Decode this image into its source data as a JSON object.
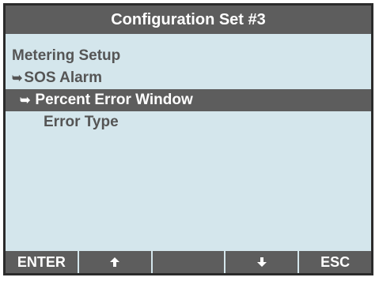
{
  "title": "Configuration Set #3",
  "menu": {
    "items": [
      {
        "label": "Metering Setup",
        "arrow": ""
      },
      {
        "label": "SOS Alarm",
        "arrow": "➥"
      },
      {
        "label": "Percent Error Window",
        "arrow": "➥"
      },
      {
        "label": "Error Type",
        "arrow": ""
      }
    ],
    "selected_index": 2
  },
  "softkeys": {
    "key1": "ENTER",
    "key2_icon": "arrow-up-icon",
    "key2_glyph": "🡅",
    "key3": "",
    "key4_icon": "arrow-down-icon",
    "key4_glyph": "🡇",
    "key5": "ESC"
  },
  "colors": {
    "screen_bg": "#d4e6ec",
    "bar_bg": "#5d5d5d",
    "text": "#555555",
    "inverse_text": "#ffffff"
  }
}
